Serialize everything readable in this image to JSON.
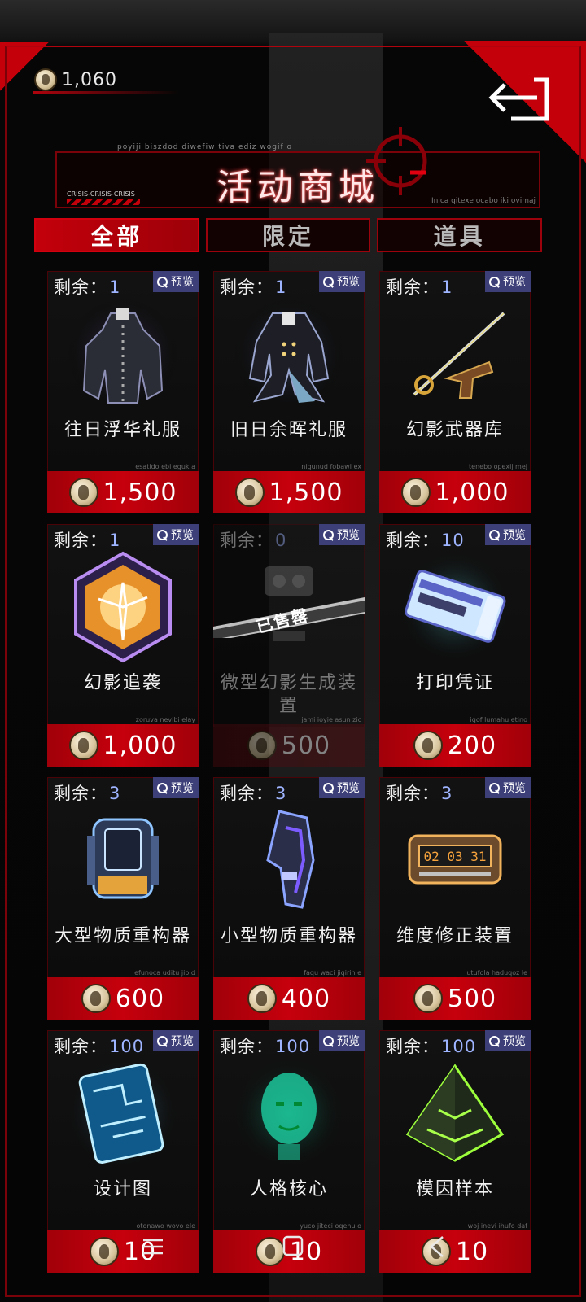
{
  "header": {
    "currency_value": "1,060",
    "title": "活动商城",
    "banner_small_top": "poyiji biszdod diwefiw tiva ediz wogif o",
    "banner_crisis": "CRISIS-CRISIS-CRISIS",
    "banner_small_br": "Inica qitexe ocabo iki ovimaj"
  },
  "tabs": [
    {
      "label": "全部",
      "active": true
    },
    {
      "label": "限定",
      "active": false
    },
    {
      "label": "道具",
      "active": false
    }
  ],
  "remain_label": "剩余：",
  "preview_label": "预览",
  "soldout_label": "已售罄",
  "items": [
    {
      "remain": "1",
      "name": "往日浮华礼服",
      "price": "1,500",
      "tiny": "esatido ebi eguk a",
      "icon": "dress-coat-icon"
    },
    {
      "remain": "1",
      "name": "旧日余晖礼服",
      "price": "1,500",
      "tiny": "nigunud fobawi ex",
      "icon": "tailcoat-icon"
    },
    {
      "remain": "1",
      "name": "幻影武器库",
      "price": "1,000",
      "tiny": "tenebo opexij mej",
      "icon": "sword-pistol-icon"
    },
    {
      "remain": "1",
      "name": "幻影追袭",
      "price": "1,000",
      "tiny": "zoruva nevibi elay",
      "icon": "hexagon-badge-icon"
    },
    {
      "remain": "0",
      "name": "微型幻影生成装置",
      "price": "500",
      "tiny": "jami ioyie asun zic",
      "icon": "device-icon",
      "soldout": true
    },
    {
      "remain": "10",
      "name": "打印凭证",
      "price": "200",
      "tiny": "iqof lumahu etino",
      "icon": "ticket-icon"
    },
    {
      "remain": "3",
      "name": "大型物质重构器",
      "price": "600",
      "tiny": "efunoca uditu jip d",
      "icon": "backpack-icon"
    },
    {
      "remain": "3",
      "name": "小型物质重构器",
      "price": "400",
      "tiny": "faqu waci jiqirih e",
      "icon": "gauntlet-icon"
    },
    {
      "remain": "3",
      "name": "维度修正装置",
      "price": "500",
      "tiny": "utufola haduqoz le",
      "icon": "module-icon"
    },
    {
      "remain": "100",
      "name": "设计图",
      "price": "10",
      "tiny": "otonawo wovo ele",
      "icon": "blueprint-icon"
    },
    {
      "remain": "100",
      "name": "人格核心",
      "price": "10",
      "tiny": "yuco jiteci oqehu o",
      "icon": "hologram-head-icon"
    },
    {
      "remain": "100",
      "name": "模因样本",
      "price": "10",
      "tiny": "woj inevi ihufo daf",
      "icon": "pyramid-icon"
    }
  ],
  "colors": {
    "accent": "#c4000b",
    "preview": "#3c3f78",
    "remain_num": "#9fb4ff"
  }
}
